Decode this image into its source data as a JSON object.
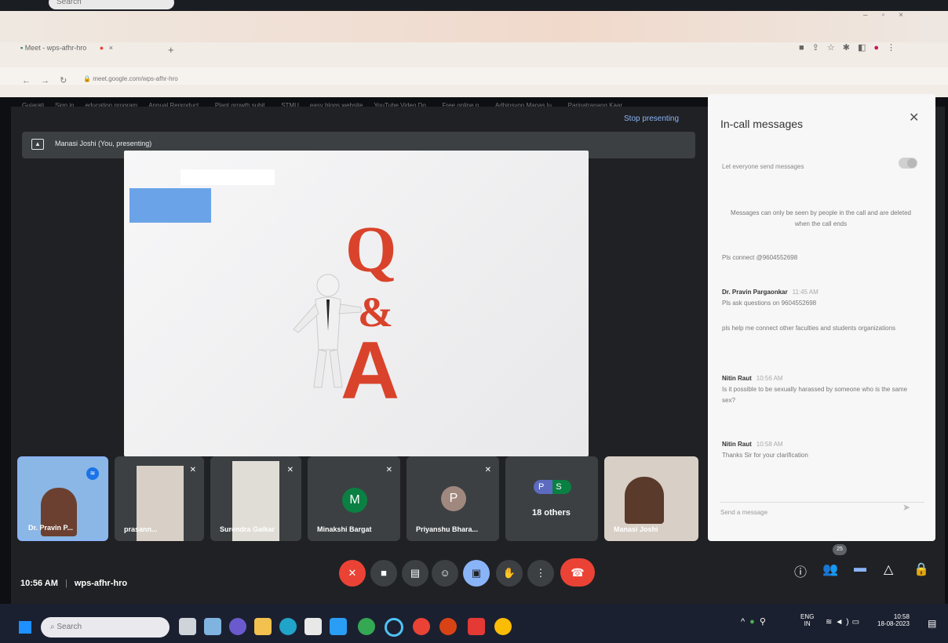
{
  "top_taskbar": {
    "search_label": "Search"
  },
  "browser": {
    "tab_title": "Meet - wps-afhr-hro",
    "url": "meet.google.com/wps-afhr-hro",
    "bookmarks": [
      "Gujarati",
      "Sign in",
      "education program",
      "Annual Reproduct...",
      "Plant growth subjt...",
      "STMU",
      "easy blogs website",
      "YouTube Video Do...",
      "Free online p...",
      "Adhinsyon Manas lu...",
      "Paripatranang Kaar"
    ]
  },
  "meet": {
    "stop_presenting": "Stop presenting",
    "presenter_label": "Manasi Joshi (You, presenting)",
    "slide": {
      "q_glyph": "Q",
      "amp_glyph": "&",
      "a_glyph": "A"
    },
    "clock": "10:56 AM",
    "meeting_code": "wps-afhr-hro",
    "participants_count": "25",
    "tiles": [
      {
        "name": "Dr. Pravin P...",
        "initial": ""
      },
      {
        "name": "prasann...",
        "initial": ""
      },
      {
        "name": "Surendra Gaikar",
        "initial": ""
      },
      {
        "name": "Minakshi Bargat",
        "initial": "M"
      },
      {
        "name": "Priyanshu Bhara...",
        "initial": "P"
      },
      {
        "name": "18 others",
        "initial": "P S"
      },
      {
        "name": "Manasi Joshi",
        "initial": ""
      }
    ]
  },
  "panel": {
    "title": "In-call messages",
    "toggle_label": "Let everyone send messages",
    "notice": "Messages can only be seen by people in the call and are deleted when the call ends",
    "messages": [
      {
        "sender": "",
        "time": "",
        "text": "Pls connect @9604552698"
      },
      {
        "sender": "Dr. Pravin Pargaonkar",
        "time": "11:45 AM",
        "text": "Pls ask questions on 9604552698"
      },
      {
        "sender": "",
        "time": "",
        "text": "pls help me connect other faculties and students organizations"
      },
      {
        "sender": "Nitin Raut",
        "time": "10:56 AM",
        "text": "Is it possible to be sexually harassed by someone who is the same sex?"
      },
      {
        "sender": "Nitin Raut",
        "time": "10:58 AM",
        "text": "Thanks Sir for your clarification"
      }
    ],
    "send_placeholder": "Send a message"
  },
  "windows_taskbar": {
    "search_label": "Search",
    "lang_1": "ENG",
    "lang_2": "IN",
    "time": "10:58",
    "date": "18-08-2023"
  },
  "colors": {
    "meet_bg": "#202124",
    "tile_bg": "#3c4043",
    "accent_blue": "#8ab4f8",
    "hangup_red": "#ea4335",
    "qa_red": "#d9432b"
  }
}
